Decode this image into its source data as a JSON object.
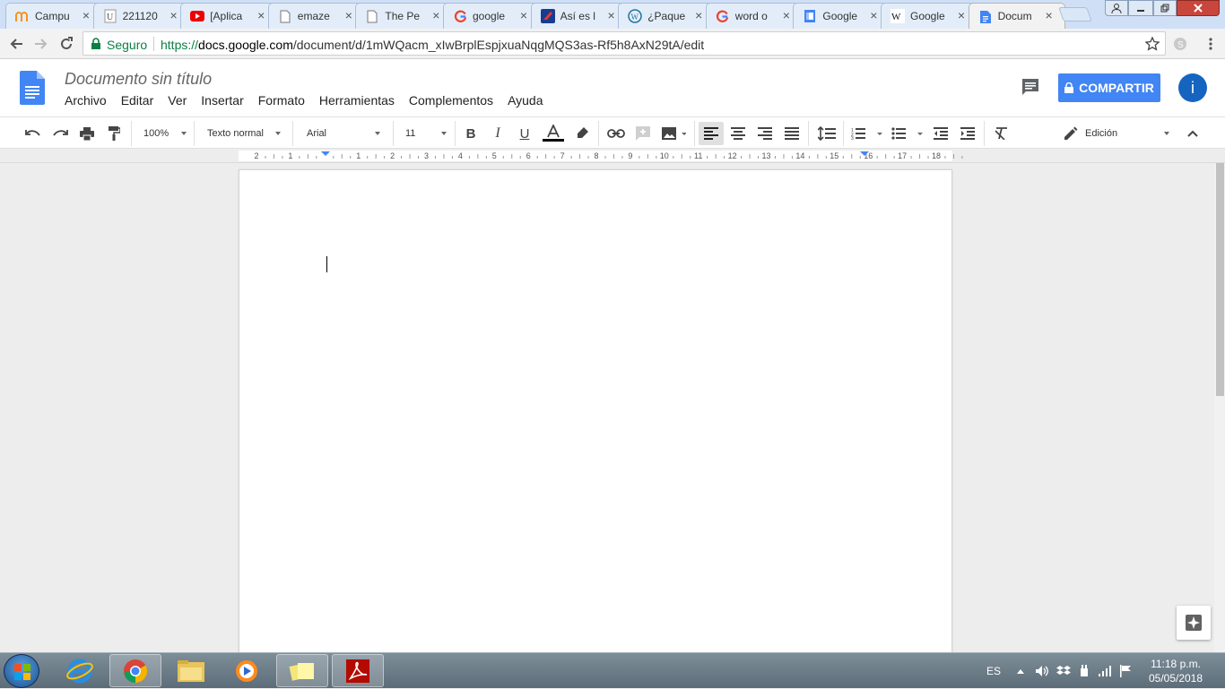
{
  "browser": {
    "tabs": [
      {
        "title": "Campu",
        "icon": "moodle-icon"
      },
      {
        "title": "221120",
        "icon": "university-icon"
      },
      {
        "title": "[Aplica",
        "icon": "youtube-icon"
      },
      {
        "title": "emaze",
        "icon": "document-icon"
      },
      {
        "title": "The Pe",
        "icon": "document-icon"
      },
      {
        "title": "google",
        "icon": "google-icon"
      },
      {
        "title": "Así es l",
        "icon": "red-site-icon"
      },
      {
        "title": "¿Paque",
        "icon": "wordpress-icon"
      },
      {
        "title": "word o",
        "icon": "google-icon"
      },
      {
        "title": "Google",
        "icon": "google-sites-icon"
      },
      {
        "title": "Google",
        "icon": "wikipedia-icon"
      },
      {
        "title": "Docum",
        "icon": "google-docs-icon"
      }
    ],
    "secure_label": "Seguro",
    "url_scheme": "https://",
    "url_host": "docs.google.com",
    "url_path": "/document/d/1mWQacm_xIwBrplEspjxuaNqgMQS3as-Rf5h8AxN29tA/edit"
  },
  "docs": {
    "title": "Documento sin título",
    "menu": [
      "Archivo",
      "Editar",
      "Ver",
      "Insertar",
      "Formato",
      "Herramientas",
      "Complementos",
      "Ayuda"
    ],
    "share_label": "COMPARTIR",
    "avatar_letter": "i",
    "toolbar": {
      "zoom": "100%",
      "style": "Texto normal",
      "font": "Arial",
      "size": "11",
      "mode": "Edición"
    },
    "ruler_marks": [
      "2",
      "1",
      "",
      "1",
      "2",
      "3",
      "4",
      "5",
      "6",
      "7",
      "8",
      "9",
      "10",
      "11",
      "12",
      "13",
      "14",
      "15",
      "16",
      "17",
      "18"
    ]
  },
  "taskbar": {
    "language": "ES",
    "time": "11:18 p.m.",
    "date": "05/05/2018"
  },
  "colors": {
    "accent": "#4285f4",
    "docs_blue": "#4285f4",
    "secure_green": "#0b8043",
    "avatar": "#1565c0"
  }
}
